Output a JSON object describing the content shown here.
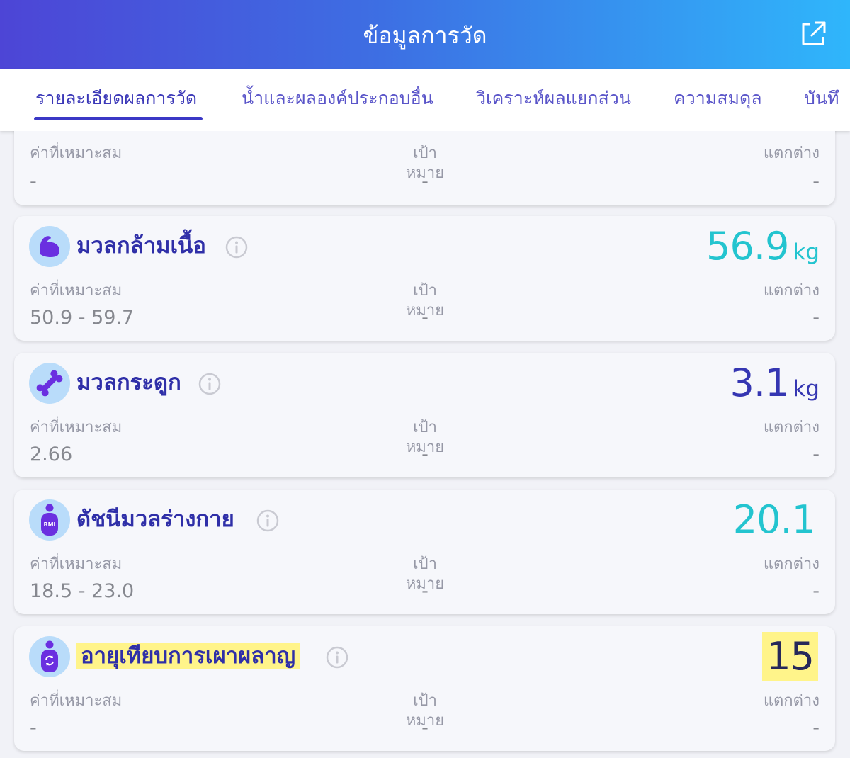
{
  "header": {
    "title": "ข้อมูลการวัด",
    "share_icon": "external-link-icon"
  },
  "tabs": [
    {
      "label": "รายละเอียดผลการวัด",
      "active": true
    },
    {
      "label": "น้ำและผลองค์ประกอบอื่น",
      "active": false
    },
    {
      "label": "วิเคราะห์ผลแยกส่วน",
      "active": false
    },
    {
      "label": "ความสมดุล",
      "active": false
    },
    {
      "label": "บันทึ",
      "active": false
    }
  ],
  "columns": {
    "ideal": "ค่าที่เหมาะสม",
    "target": "เป้าหมาย",
    "difference": "แตกต่าง"
  },
  "partial_card": {
    "ideal": "-",
    "target": "-",
    "difference": "-"
  },
  "cards": [
    {
      "title": "มวลกล้ามเนื้อ",
      "icon": "muscle-icon",
      "value": "56.9",
      "unit": "kg",
      "value_color": "#23c4cf",
      "ideal": "50.9  -  59.7",
      "target": "-",
      "difference": "-"
    },
    {
      "title": "มวลกระดูก",
      "icon": "bone-icon",
      "value": "3.1",
      "unit": "kg",
      "value_color": "#3536b2",
      "ideal": "2.66",
      "target": "-",
      "difference": "-"
    },
    {
      "title": "ดัชนีมวลร่างกาย",
      "icon": "bmi-body-icon",
      "icon_text": "BMI",
      "value": "20.1",
      "unit": "",
      "value_color": "#23c4cf",
      "ideal": "18.5  -  23.0",
      "target": "-",
      "difference": "-"
    },
    {
      "title": "อายุเทียบการเผาผลาญ",
      "icon": "metabolic-age-icon",
      "value": "15",
      "unit": "",
      "value_color": "#26285a",
      "highlighted": true,
      "ideal": "-",
      "target": "-",
      "difference": "-"
    }
  ],
  "colors": {
    "header_start": "#4d45d6",
    "header_end": "#2fb6fb",
    "accent": "#3b38c6",
    "icon_bg": "#b9dcfa",
    "icon_fg": "#6a2fe0",
    "highlight": "#fff48a"
  }
}
